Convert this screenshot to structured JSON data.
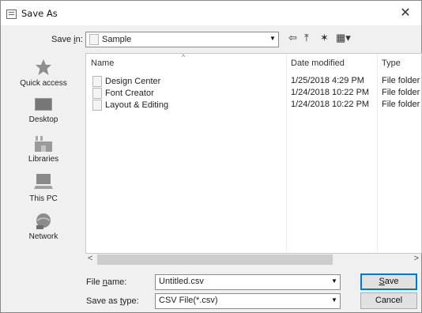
{
  "window": {
    "title": "Save As",
    "close_glyph": "✕"
  },
  "save_in": {
    "label_pre": "Save ",
    "label_key": "i",
    "label_post": "n:",
    "value": "Sample"
  },
  "toolbar": {
    "back_glyph": "⇦",
    "up_glyph": "⤒",
    "new_folder_glyph": "✶",
    "view_glyph": "▦▾"
  },
  "places": [
    {
      "label": "Quick access",
      "icon": "star-icon"
    },
    {
      "label": "Desktop",
      "icon": "desktop-icon"
    },
    {
      "label": "Libraries",
      "icon": "libraries-icon"
    },
    {
      "label": "This PC",
      "icon": "computer-icon"
    },
    {
      "label": "Network",
      "icon": "network-icon"
    }
  ],
  "list": {
    "columns": [
      "Name",
      "Date modified",
      "Type"
    ],
    "sort_glyph": "^",
    "rows": [
      {
        "name": "Design Center",
        "date": "1/25/2018 4:29 PM",
        "type": "File folder"
      },
      {
        "name": "Font Creator",
        "date": "1/24/2018 10:22 PM",
        "type": "File folder"
      },
      {
        "name": "Layout & Editing",
        "date": "1/24/2018 10:22 PM",
        "type": "File folder"
      }
    ]
  },
  "scroll": {
    "left_glyph": "<",
    "right_glyph": ">"
  },
  "file_name": {
    "label_pre": "File ",
    "label_key": "n",
    "label_post": "ame:",
    "value": "Untitled.csv"
  },
  "save_type": {
    "label_pre": "Save as ",
    "label_key": "t",
    "label_post": "ype:",
    "value": "CSV File(*.csv)"
  },
  "buttons": {
    "save_key": "S",
    "save_rest": "ave",
    "cancel": "Cancel"
  },
  "colors": {
    "accent": "#0078d7",
    "folder": "#e8c66a"
  }
}
